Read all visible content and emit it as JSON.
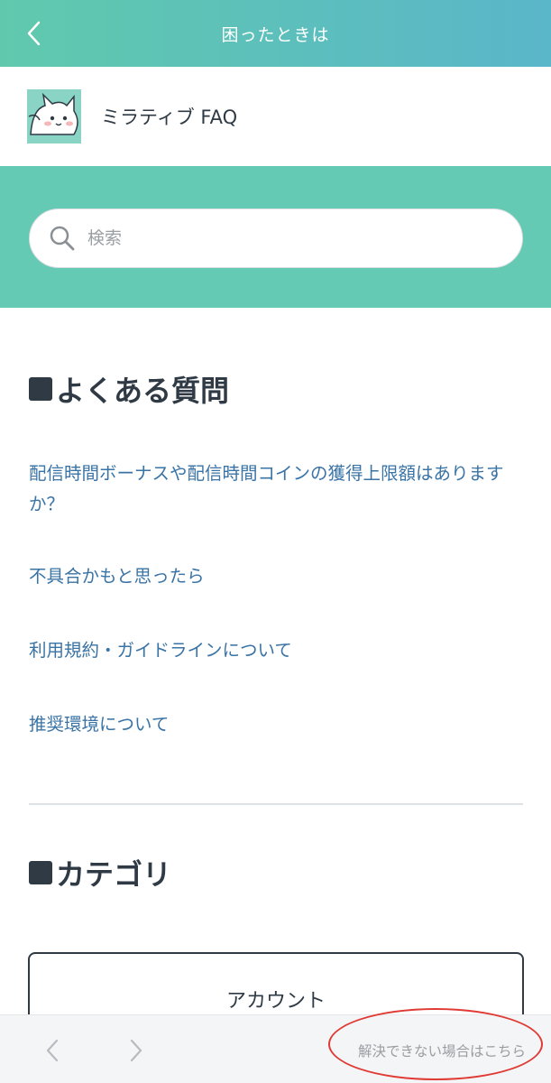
{
  "header": {
    "title": "困ったときは",
    "back_icon": "chevron-left-icon"
  },
  "brand": {
    "name": "ミラティブ FAQ",
    "logo": "cat-mascot-logo"
  },
  "search": {
    "placeholder": "検索",
    "icon": "search-icon"
  },
  "faq": {
    "title": "よくある質問",
    "items": [
      {
        "label": "配信時間ボーナスや配信時間コインの獲得上限額はありますか？"
      },
      {
        "label": "不具合かもと思ったら"
      },
      {
        "label": "利用規約・ガイドラインについて"
      },
      {
        "label": "推奨環境について"
      }
    ]
  },
  "categories": {
    "title": "カテゴリ",
    "items": [
      {
        "label": "アカウント"
      }
    ]
  },
  "bottom_bar": {
    "unresolved_label": "解決できない場合はこちら"
  },
  "colors": {
    "header_gradient_start": "#60c9ad",
    "header_gradient_end": "#5ab6c9",
    "search_band": "#65cab3",
    "link": "#3a73a5",
    "annotation_circle": "#e03a34"
  }
}
